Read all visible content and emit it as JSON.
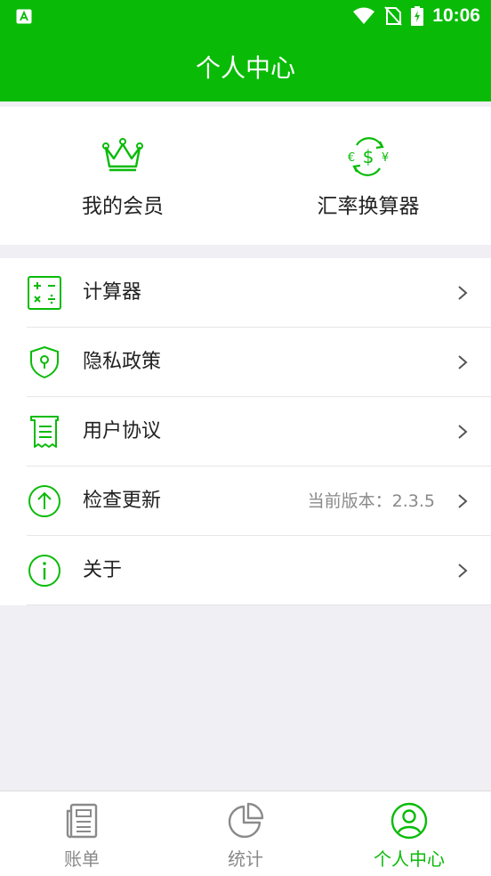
{
  "status_bar": {
    "time": "10:06"
  },
  "header": {
    "title": "个人中心"
  },
  "shortcuts": [
    {
      "label": "我的会员",
      "icon": "crown-icon"
    },
    {
      "label": "汇率换算器",
      "icon": "currency-exchange-icon"
    }
  ],
  "menu": [
    {
      "label": "计算器",
      "icon": "calculator-icon",
      "value": ""
    },
    {
      "label": "隐私政策",
      "icon": "shield-icon",
      "value": ""
    },
    {
      "label": "用户协议",
      "icon": "document-icon",
      "value": ""
    },
    {
      "label": "检查更新",
      "icon": "arrow-up-circle-icon",
      "value": "当前版本：2.3.5"
    },
    {
      "label": "关于",
      "icon": "info-icon",
      "value": ""
    }
  ],
  "tabs": [
    {
      "label": "账单",
      "icon": "bill-icon",
      "active": false
    },
    {
      "label": "统计",
      "icon": "pie-chart-icon",
      "active": false
    },
    {
      "label": "个人中心",
      "icon": "user-icon",
      "active": true
    }
  ],
  "colors": {
    "brand": "#09bb07",
    "background": "#efeff4",
    "inactive": "#8a8a8a"
  }
}
